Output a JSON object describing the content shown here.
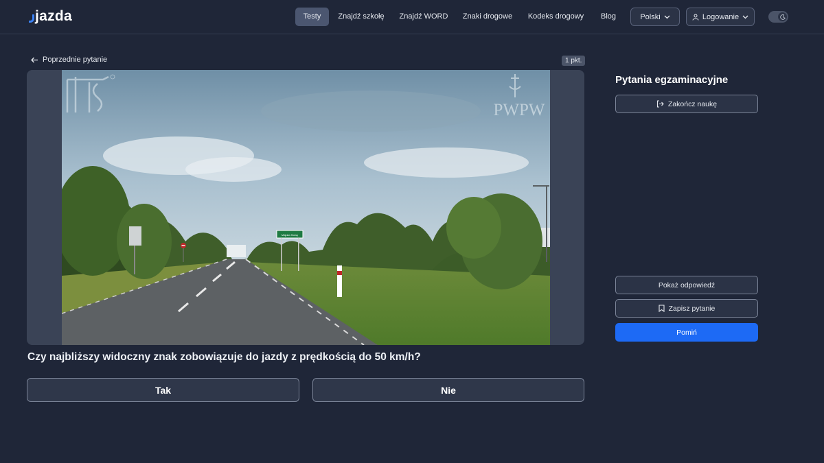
{
  "header": {
    "logo": "jazda",
    "nav": [
      {
        "label": "Testy",
        "active": true
      },
      {
        "label": "Znajdź szkołę"
      },
      {
        "label": "Znajdź WORD"
      },
      {
        "label": "Znaki drogowe"
      },
      {
        "label": "Kodeks drogowy"
      },
      {
        "label": "Blog"
      }
    ],
    "language": "Polski",
    "login": "Logowanie",
    "theme_icon": "moon-icon"
  },
  "question_panel": {
    "prev_label": "Poprzednie pytanie",
    "points": "1 pkt.",
    "watermark_right": "PWPW",
    "road_sign_text": "Majdan Nowy",
    "question_text": "Czy najbliższy widoczny znak zobowiązuje do jazdy z prędkością do 50 km/h?",
    "answers": [
      "Tak",
      "Nie"
    ]
  },
  "sidebar": {
    "title": "Pytania egzaminacyjne",
    "finish_label": "Zakończ naukę",
    "show_answer_label": "Pokaż odpowiedź",
    "save_label": "Zapisz pytanie",
    "skip_label": "Pomiń"
  },
  "colors": {
    "background": "#1f2638",
    "accent": "#1d6af5",
    "border": "#7b8498"
  }
}
